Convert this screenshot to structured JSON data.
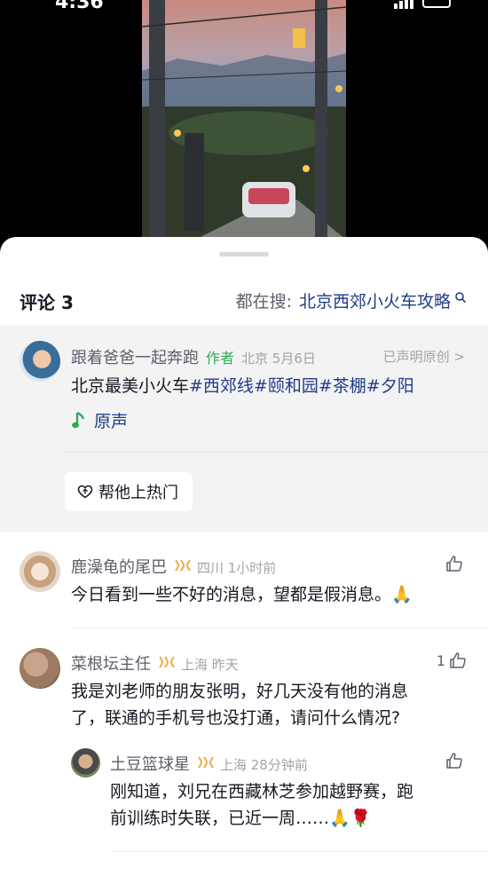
{
  "status_bar": {
    "time": "4:36"
  },
  "video": {
    "caption": ""
  },
  "sheet": {
    "title": "评论 3",
    "search_prefix": "都在搜:",
    "search_term": "北京西郊小火车攻略"
  },
  "author_post": {
    "name": "跟着爸爸一起奔跑",
    "tag": "作者",
    "meta": "北京 5月6日",
    "original_claim": "已声明原创 >",
    "text": "北京最美小火车",
    "hashtags": [
      "#西郊线",
      "#颐和园",
      "#茶棚",
      "#夕阳"
    ],
    "music_label": "原声",
    "boost_label": "帮他上热门"
  },
  "comments": [
    {
      "name": "鹿澡龟的尾巴",
      "meta": "四川 1小时前",
      "text": "今日看到一些不好的消息，望都是假消息。🙏",
      "likes": ""
    },
    {
      "name": "菜根坛主任",
      "meta": "上海 昨天",
      "text_line1": "我是刘老师的朋友张明，好几天没有他的消息",
      "text_line2": "了，联通的手机号也没打通，请问什么情况?",
      "likes": "1"
    },
    {
      "name": "土豆篮球星",
      "meta": "上海 28分钟前",
      "text_line1": "刚知道，刘兄在西藏林芝参加越野赛，跑",
      "text_line2": "前训练时失联，已近一周……🙏🌹",
      "likes": ""
    }
  ],
  "colors": {
    "accent_link": "#1f3c87",
    "author_tag": "#2fab55",
    "badge": "#f0a73a"
  }
}
